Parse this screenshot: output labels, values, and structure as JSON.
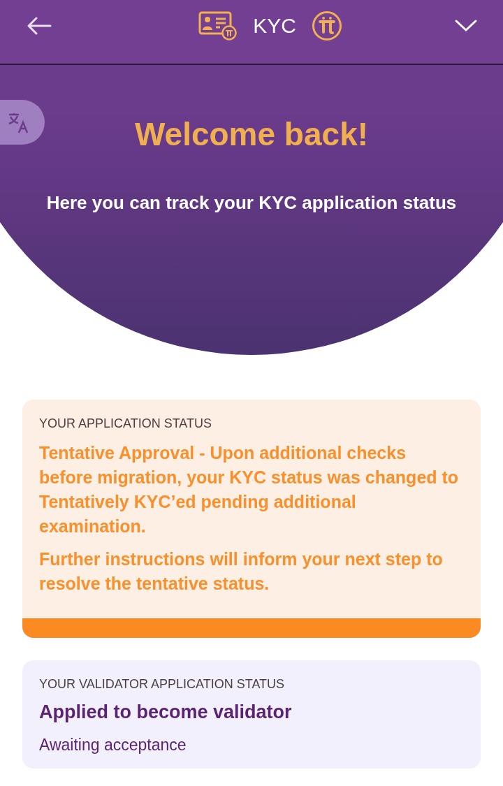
{
  "header": {
    "title": "KYC"
  },
  "hero": {
    "heading": "Welcome back!",
    "subheading": "Here you can track your KYC application status"
  },
  "cards": [
    {
      "kind": "warning",
      "label": "YOUR APPLICATION STATUS",
      "paragraphs": [
        "Tentative Approval - Upon additional checks before migration, your KYC status was changed to Tentatively KYC’ed pending additional examination.",
        "Further instructions will inform your next step to resolve the tentative status."
      ]
    },
    {
      "kind": "info",
      "label": "YOUR VALIDATOR APPLICATION STATUS",
      "title": "Applied to become validator",
      "detail": "Awaiting acceptance"
    }
  ]
}
